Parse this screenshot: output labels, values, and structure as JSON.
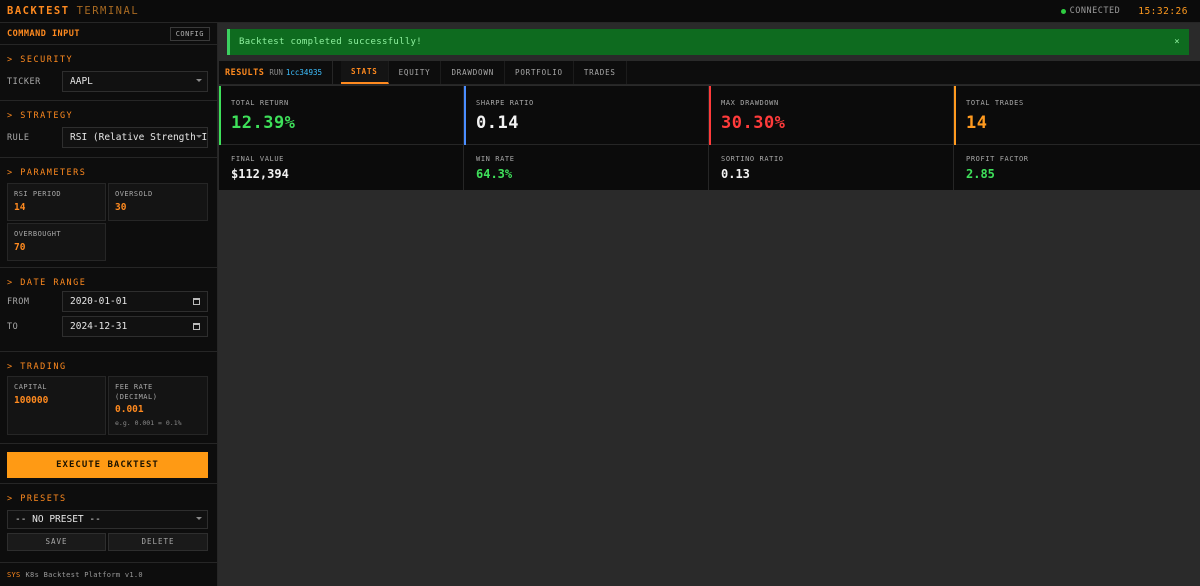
{
  "app": {
    "brand": "BACKTEST",
    "brand_sub": "TERMINAL",
    "status": "CONNECTED",
    "clock": "15:32:26"
  },
  "sidebar": {
    "title": "COMMAND INPUT",
    "config_label": "CONFIG",
    "security": {
      "title": "> SECURITY",
      "ticker_label": "TICKER",
      "ticker_value": "AAPL"
    },
    "strategy": {
      "title": "> STRATEGY",
      "rule_label": "RULE",
      "rule_value": "RSI (Relative Strength Index)"
    },
    "parameters": {
      "title": "> PARAMETERS",
      "rsi_period_label": "RSI PERIOD",
      "rsi_period_value": "14",
      "oversold_label": "OVERSOLD",
      "oversold_value": "30",
      "overbought_label": "OVERBOUGHT",
      "overbought_value": "70"
    },
    "date_range": {
      "title": "> DATE RANGE",
      "from_label": "FROM",
      "from_value": "2020-01-01",
      "to_label": "TO",
      "to_value": "2024-12-31"
    },
    "trading": {
      "title": "> TRADING",
      "capital_label": "CAPITAL",
      "capital_value": "100000",
      "fee_label_1": "FEE RATE",
      "fee_label_2": "(DECIMAL)",
      "fee_value": "0.001",
      "fee_hint": "e.g. 0.001 = 0.1%"
    },
    "execute_label": "EXECUTE BACKTEST",
    "presets": {
      "title": "> PRESETS",
      "selected": "-- NO PRESET --",
      "save_label": "SAVE",
      "delete_label": "DELETE"
    },
    "footer": {
      "sys": "SYS",
      "text": "K8s Backtest Platform v1.0"
    }
  },
  "alert": {
    "message": "Backtest completed successfully!",
    "close": "×"
  },
  "results": {
    "title": "RESULTS",
    "run_label": "RUN",
    "run_id": "1cc34935",
    "tabs": [
      "STATS",
      "EQUITY",
      "DRAWDOWN",
      "PORTFOLIO",
      "TRADES"
    ]
  },
  "stats": {
    "primary": [
      {
        "label": "TOTAL RETURN",
        "value": "12.39%",
        "color": "#3ee05a"
      },
      {
        "label": "SHARPE RATIO",
        "value": "0.14",
        "color": "#f2f2f2"
      },
      {
        "label": "MAX DRAWDOWN",
        "value": "30.30%",
        "color": "#ff3b3b"
      },
      {
        "label": "TOTAL TRADES",
        "value": "14",
        "color": "#ff9a1f"
      }
    ],
    "secondary": [
      {
        "label": "FINAL VALUE",
        "value": "$112,394",
        "color": "#f2f2f2"
      },
      {
        "label": "WIN RATE",
        "value": "64.3%",
        "color": "#3ee05a"
      },
      {
        "label": "SORTINO RATIO",
        "value": "0.13",
        "color": "#f2f2f2"
      },
      {
        "label": "PROFIT FACTOR",
        "value": "2.85",
        "color": "#3ee05a"
      }
    ],
    "accents": [
      "#3ee05a",
      "#4a8dff",
      "#ff3b3b",
      "#ff9a1f"
    ]
  }
}
